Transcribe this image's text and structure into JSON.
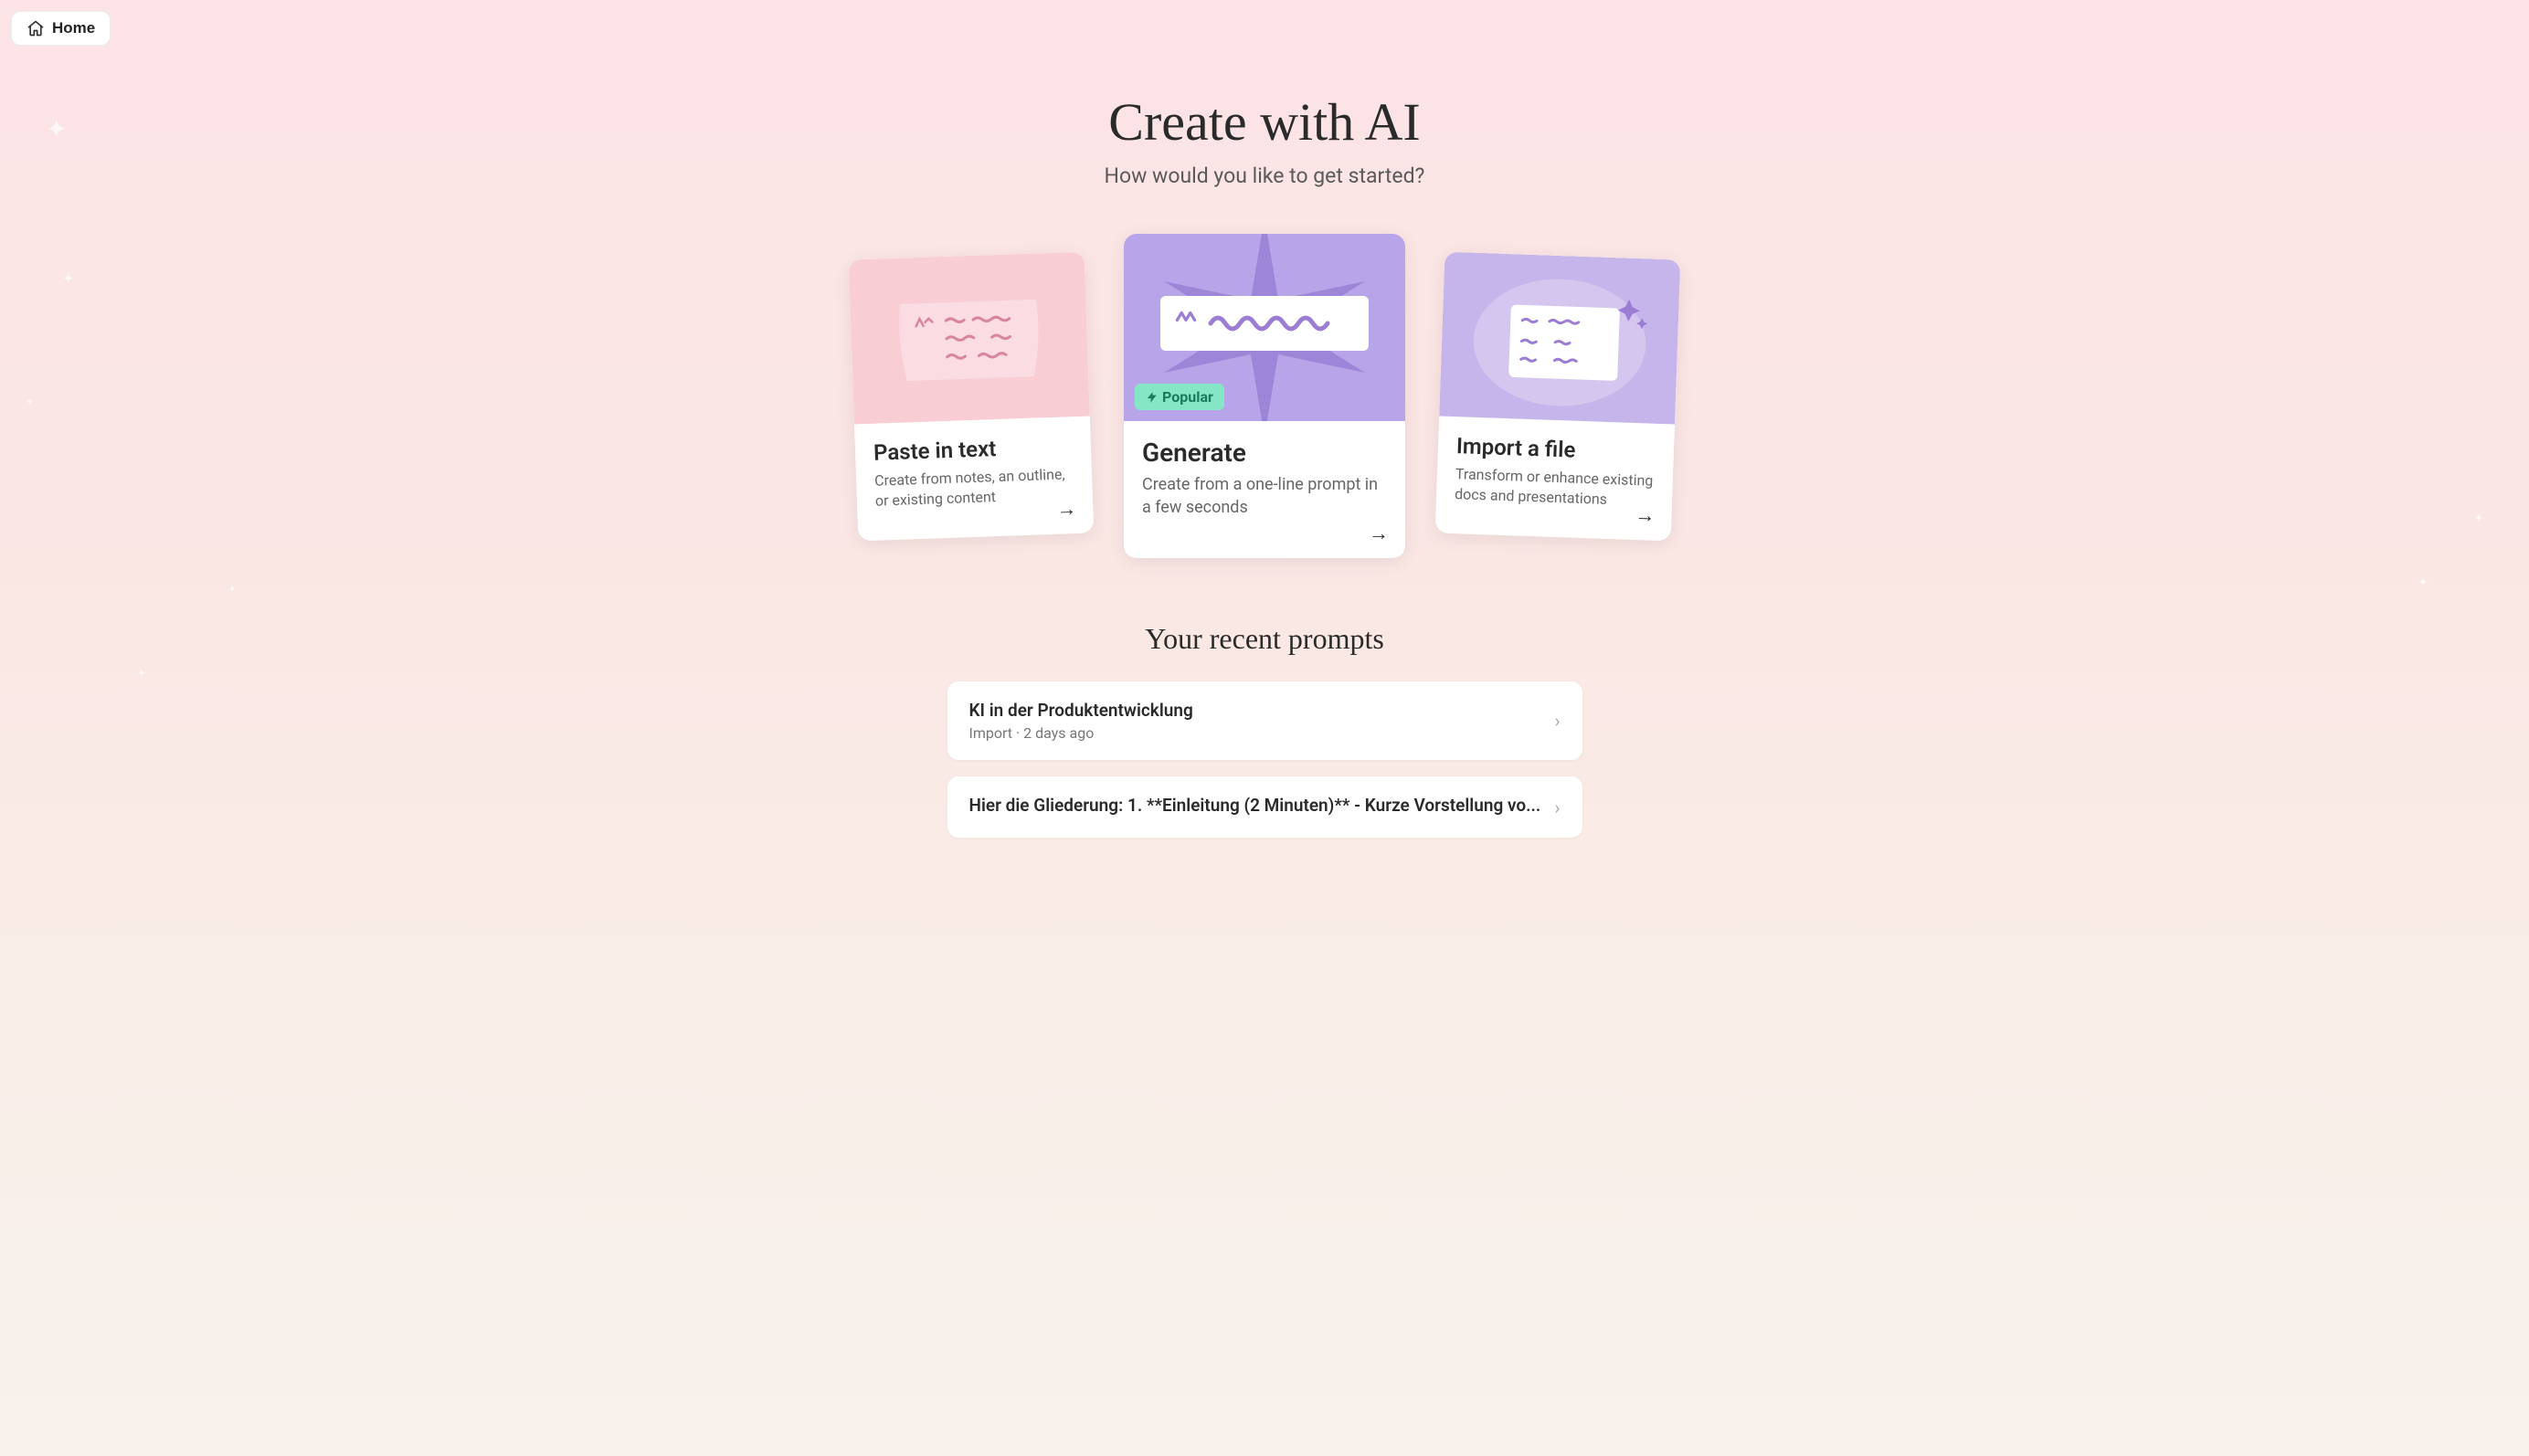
{
  "nav": {
    "home_label": "Home"
  },
  "hero": {
    "title": "Create with AI",
    "subtitle": "How would you like to get started?"
  },
  "cards": [
    {
      "title": "Paste in text",
      "desc": "Create from notes, an outline, or existing content",
      "badge": null
    },
    {
      "title": "Generate",
      "desc": "Create from a one-line prompt in a few seconds",
      "badge": "Popular"
    },
    {
      "title": "Import a file",
      "desc": "Transform or enhance existing docs and presentations",
      "badge": null
    }
  ],
  "recent": {
    "heading": "Your recent prompts",
    "items": [
      {
        "title": "KI in der Produktentwicklung",
        "meta": "Import · 2 days ago"
      },
      {
        "title": "Hier die Gliederung: 1. **Einleitung (2 Minuten)** - Kurze Vorstellung vo...",
        "meta": ""
      }
    ]
  }
}
